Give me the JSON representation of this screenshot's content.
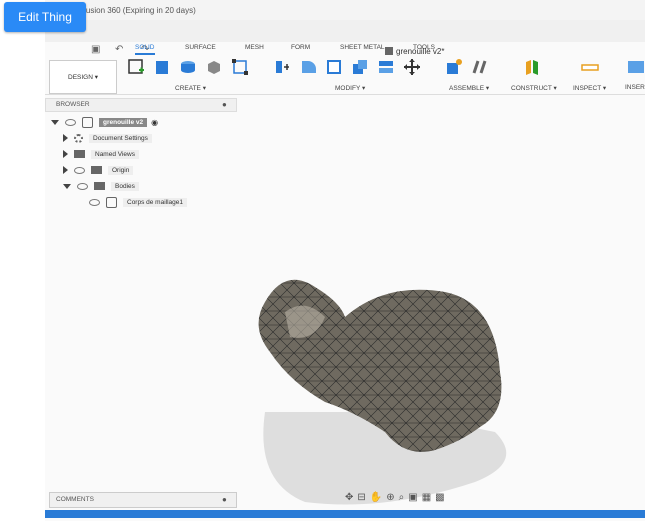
{
  "window_title": "Fusion 360 (Expiring in 20 days)",
  "doc_title": "grenouille v2*",
  "workspace": "DESIGN ▾",
  "mode_tabs": [
    "SOLID",
    "SURFACE",
    "MESH",
    "FORM",
    "SHEET METAL",
    "TOOLS"
  ],
  "ribbon_groups": [
    "CREATE ▾",
    "MODIFY ▾",
    "ASSEMBLE ▾",
    "CONSTRUCT ▾",
    "INSPECT ▾",
    "INSER"
  ],
  "browser": {
    "title": "BROWSER",
    "root": "grenouille v2",
    "items": [
      "Document Settings",
      "Named Views",
      "Origin",
      "Bodies"
    ],
    "body": "Corps de maillage1"
  },
  "comments_label": "COMMENTS",
  "edit_button": "Edit Thing",
  "colors": {
    "accent": "#2a7bd6",
    "button": "#2a8af6",
    "model": "#6f6a60"
  }
}
